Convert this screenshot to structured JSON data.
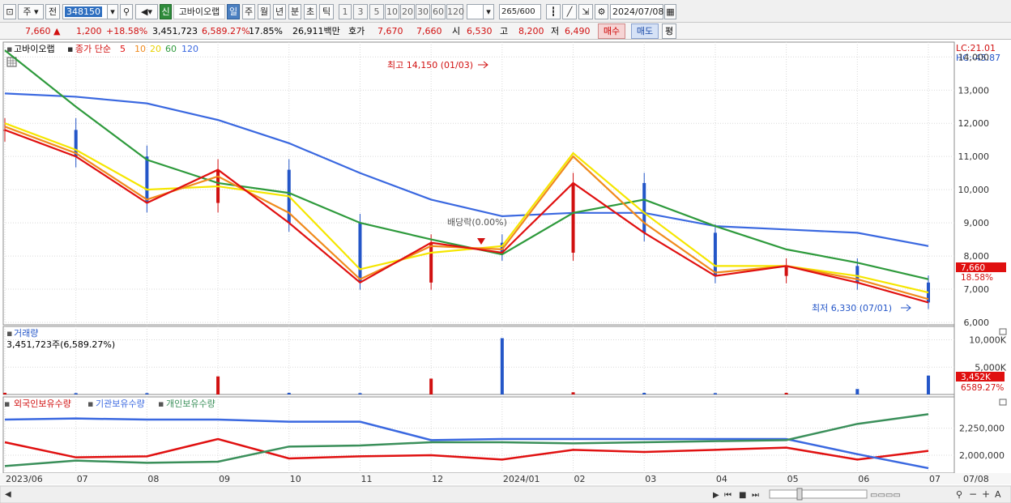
{
  "toolbar": {
    "period_select": "주",
    "prev_label": "전",
    "stock_code": "348150",
    "badge_new": "신",
    "stock_name": "고바이오랩",
    "period_tabs": [
      "일",
      "주",
      "월",
      "년",
      "분",
      "초",
      "틱"
    ],
    "interval_buttons": [
      "1",
      "3",
      "5",
      "10",
      "20",
      "30",
      "60",
      "120"
    ],
    "count_display": "265",
    "count_max": "/600",
    "date_display": "2024/07/08"
  },
  "quote": {
    "price": "7,660",
    "up_arrow": "▲",
    "change": "1,200",
    "change_pct": "+18.58%",
    "volume": "3,451,723",
    "volume_ratio": "6,589.27%",
    "turnover": "17.85%",
    "amount": "26,911백만",
    "ask_label": "호가",
    "ask_price": "7,670",
    "bid_price": "7,660",
    "open_label": "시",
    "open": "6,530",
    "high_label": "고",
    "high": "8,200",
    "low_label": "저",
    "low": "6,490",
    "buy_label": "매수",
    "sell_label": "매도",
    "avg_label": "평"
  },
  "price_panel": {
    "legend_title": "고바이오랩",
    "legend_ma_label": "종가 단순",
    "legend_periods": [
      "5",
      "10",
      "20",
      "60",
      "120"
    ],
    "lc_label": "LC:21.01",
    "hc_label": "HC:-45.87",
    "high_note": "최고 14,150 (01/03)",
    "low_note": "최저 6,330 (07/01)",
    "dividend_note": "배당락(0.00%)",
    "current_price_tag": "7,660",
    "current_pct_tag": "18.58%",
    "y_ticks": [
      "14,000",
      "13,000",
      "12,000",
      "11,000",
      "10,000",
      "9,000",
      "8,000",
      "7,000",
      "6,000"
    ]
  },
  "volume_panel": {
    "title": "거래량",
    "subtitle": "3,451,723주(6,589.27%)",
    "y_ticks": [
      "10,000K",
      "5,000K"
    ],
    "current_tag": "3,452K",
    "current_pct_tag": "6589.27%"
  },
  "holdings_panel": {
    "legend": [
      "외국인보유수량",
      "기관보유수량",
      "개인보유수량"
    ],
    "y_ticks": [
      "2,250,000",
      "2,000,000"
    ]
  },
  "x_axis": {
    "labels": [
      "2023/06",
      "07",
      "08",
      "09",
      "10",
      "11",
      "12",
      "2024/01",
      "02",
      "03",
      "04",
      "05",
      "06",
      "07",
      "07/08"
    ]
  },
  "colors": {
    "up": "#d11010",
    "down": "#2456c8",
    "ma5": "#e01010",
    "ma10": "#f08a1c",
    "ma20": "#f5e600",
    "ma60": "#2e9a3c",
    "ma120": "#3a68e0",
    "foreign": "#e01010",
    "institution": "#3a68e0",
    "individual": "#3a8f5a"
  },
  "chart_data": [
    {
      "type": "line",
      "title": "고바이오랩",
      "x": [
        "2023/06",
        "07",
        "08",
        "09",
        "10",
        "11",
        "12",
        "2024/01",
        "02",
        "03",
        "04",
        "05",
        "06",
        "07"
      ],
      "ylim": [
        6000,
        14300
      ],
      "series": [
        {
          "name": "5",
          "values": [
            11800,
            11000,
            9600,
            10600,
            9000,
            7200,
            8400,
            8100,
            10200,
            8700,
            7400,
            7700,
            7200,
            6600
          ]
        },
        {
          "name": "10",
          "values": [
            11900,
            11100,
            9700,
            10400,
            9300,
            7300,
            8300,
            8200,
            11000,
            9000,
            7500,
            7700,
            7300,
            6700
          ]
        },
        {
          "name": "20",
          "values": [
            12000,
            11200,
            10000,
            10100,
            9800,
            7600,
            8100,
            8300,
            11100,
            9300,
            7700,
            7700,
            7400,
            6900
          ]
        },
        {
          "name": "60",
          "values": [
            14200,
            12500,
            10900,
            10200,
            9900,
            9000,
            8500,
            8050,
            9300,
            9700,
            8900,
            8200,
            7800,
            7300
          ]
        },
        {
          "name": "120",
          "values": [
            12900,
            12800,
            12600,
            12100,
            11400,
            10500,
            9700,
            9200,
            9300,
            9300,
            8900,
            8800,
            8700,
            8300
          ]
        }
      ]
    },
    {
      "type": "bar",
      "title": "거래량",
      "categories": [
        "2023/06",
        "07",
        "08",
        "09",
        "10",
        "11",
        "12",
        "2024/01",
        "02",
        "03",
        "04",
        "05",
        "06",
        "07"
      ],
      "values": [
        300,
        250,
        250,
        3300,
        300,
        250,
        2900,
        10300,
        400,
        300,
        250,
        300,
        1000,
        3452
      ],
      "ylim": [
        0,
        12000
      ]
    },
    {
      "type": "line",
      "x": [
        "2023/06",
        "07",
        "08",
        "09",
        "10",
        "11",
        "12",
        "2024/01",
        "02",
        "03",
        "04",
        "05",
        "06",
        "07"
      ],
      "ylim": [
        1850000,
        2420000
      ],
      "series": [
        {
          "name": "외국인보유수량",
          "values": [
            2120000,
            1980000,
            1990000,
            2150000,
            1970000,
            1990000,
            2000000,
            1960000,
            2050000,
            2030000,
            2050000,
            2070000,
            1960000,
            2040000
          ]
        },
        {
          "name": "기관보유수량",
          "values": [
            2330000,
            2340000,
            2330000,
            2330000,
            2310000,
            2310000,
            2140000,
            2150000,
            2150000,
            2150000,
            2150000,
            2150000,
            2010000,
            1880000
          ]
        },
        {
          "name": "개인보유수량",
          "values": [
            1900000,
            1950000,
            1930000,
            1940000,
            2080000,
            2090000,
            2120000,
            2120000,
            2110000,
            2120000,
            2130000,
            2140000,
            2290000,
            2380000
          ]
        }
      ]
    }
  ]
}
